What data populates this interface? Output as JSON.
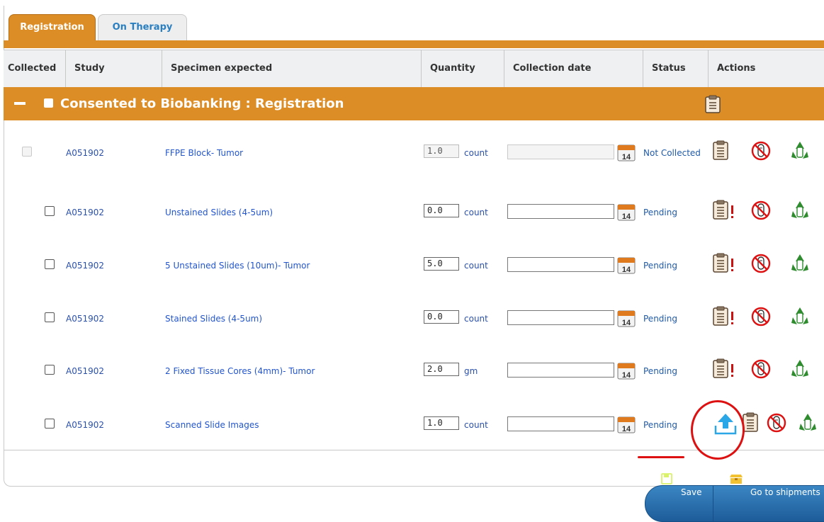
{
  "tabs": [
    {
      "label": "Registration",
      "active": true
    },
    {
      "label": "On Therapy",
      "active": false
    }
  ],
  "columns": [
    "Collected",
    "Study",
    "Specimen expected",
    "Quantity",
    "Collection date",
    "Status",
    "Actions"
  ],
  "group": {
    "title": "Consented to Biobanking : Registration"
  },
  "rows": [
    {
      "study": "A051902",
      "specimen": "FFPE Block- Tumor",
      "quantity": "1.0",
      "unit": "count",
      "status": "Not Collected",
      "disabled": true
    },
    {
      "study": "A051902",
      "specimen": "Unstained Slides (4-5um)",
      "quantity": "0.0",
      "unit": "count",
      "status": "Pending",
      "disabled": false
    },
    {
      "study": "A051902",
      "specimen": "5 Unstained Slides (10um)- Tumor",
      "quantity": "5.0",
      "unit": "count",
      "status": "Pending",
      "disabled": false
    },
    {
      "study": "A051902",
      "specimen": "Stained Slides (4-5um)",
      "quantity": "0.0",
      "unit": "count",
      "status": "Pending",
      "disabled": false
    },
    {
      "study": "A051902",
      "specimen": "2 Fixed Tissue Cores (4mm)- Tumor",
      "quantity": "2.0",
      "unit": "gm",
      "status": "Pending",
      "disabled": false
    },
    {
      "study": "A051902",
      "specimen": "Scanned Slide Images",
      "quantity": "1.0",
      "unit": "count",
      "status": "Pending",
      "disabled": false
    }
  ],
  "calendar_day": "14",
  "buttons": {
    "save": "Save",
    "ship": "Go to shipments"
  },
  "colors": {
    "accent": "#dd8d26",
    "link": "#2255cc",
    "button": "#2a6fb0",
    "annotation": "#dd1111"
  },
  "icons": [
    "clipboard-icon",
    "clipboard-alert-icon",
    "no-specimen-icon",
    "recycle-icon",
    "upload-icon",
    "calendar-icon",
    "save-icon",
    "shipment-icon"
  ]
}
